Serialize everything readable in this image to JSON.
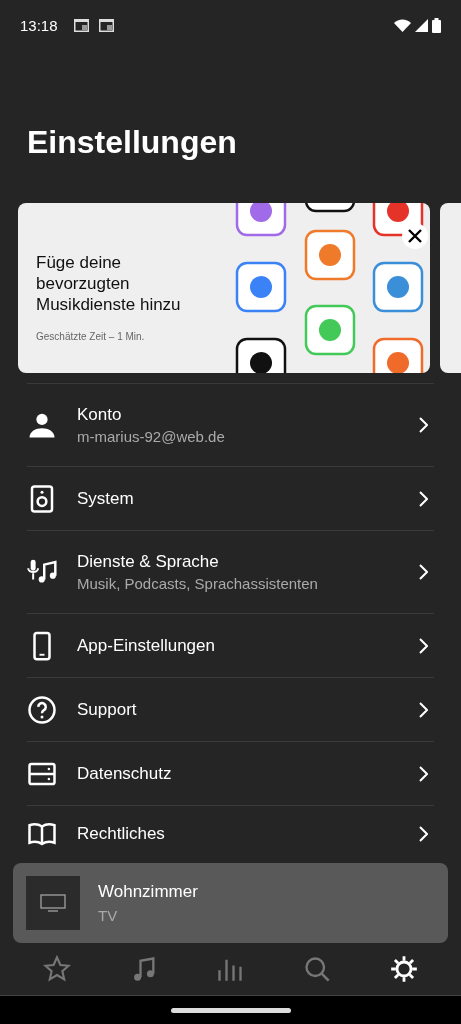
{
  "status_bar": {
    "time": "13:18"
  },
  "title": "Einstellungen",
  "cards": [
    {
      "kind": "promo",
      "title": "Füge deine bevorzugten Musikdienste hinzu",
      "subtitle": "Geschätzte Zeit – 1 Min."
    },
    {
      "kind": "peek"
    }
  ],
  "settings": [
    {
      "title": "Konto",
      "subtitle": "m-marius-92@web.de"
    },
    {
      "title": "System"
    },
    {
      "title": "Dienste & Sprache",
      "subtitle": "Musik, Podcasts, Sprachassistenten"
    },
    {
      "title": "App-Einstellungen"
    },
    {
      "title": "Support"
    },
    {
      "title": "Datenschutz"
    },
    {
      "title": "Rechtliches"
    }
  ],
  "now_playing": {
    "room": "Wohnzimmer",
    "source": "TV"
  },
  "nav": [
    {
      "selected": false
    },
    {
      "selected": false
    },
    {
      "selected": false
    },
    {
      "selected": false
    },
    {
      "selected": true
    }
  ]
}
